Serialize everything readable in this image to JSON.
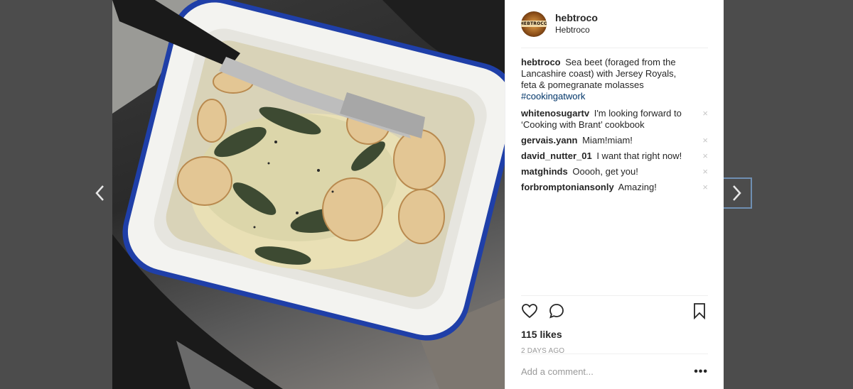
{
  "navigation": {
    "prev_icon": "chevron-left-icon",
    "next_icon": "chevron-right-icon"
  },
  "post": {
    "author": {
      "username": "hebtroco",
      "display_name": "Hebtroco",
      "avatar_text": "HEBTROCO"
    },
    "caption": {
      "username": "hebtroco",
      "text": "Sea beet (foraged from the Lancashire coast) with Jersey Royals, feta & pomegranate molasses",
      "hashtag": "#cookingatwork"
    },
    "comments": [
      {
        "username": "whitenosugartv",
        "text": "I'm looking forward to ‘Cooking with Brant’ cookbook"
      },
      {
        "username": "gervais.yann",
        "text": "Miam!miam!"
      },
      {
        "username": "david_nutter_01",
        "text": "I want that right now!"
      },
      {
        "username": "matghinds",
        "text": "Ooooh, get you!"
      },
      {
        "username": "forbromptoniansonly",
        "text": "Amazing!"
      }
    ],
    "comment_delete_glyph": "×",
    "likes": "115 likes",
    "timestamp": "2 DAYS AGO",
    "add_comment_placeholder": "Add a comment...",
    "more_glyph": "•••"
  },
  "colors": {
    "hashtag": "#003569",
    "text": "#262626",
    "muted": "#999999",
    "enamel_rim": "#1f3fa8"
  }
}
